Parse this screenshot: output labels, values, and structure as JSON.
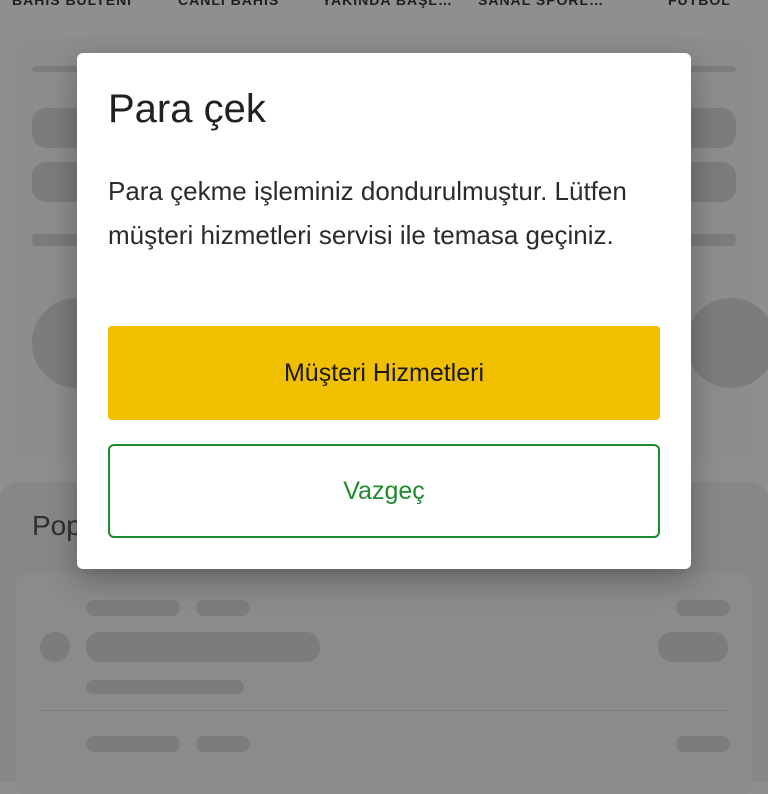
{
  "background": {
    "tabs": [
      "BAHİS BÜLTENİ",
      "CANLI BAHİS",
      "YAKINDA BAŞL…",
      "SANAL SPORL…",
      "FUTBOL"
    ],
    "popular_title": "Pop"
  },
  "dialog": {
    "title": "Para çek",
    "message": "Para çekme işleminiz dondurulmuştur. Lütfen müşteri hizmetleri servisi ile temasa geçiniz.",
    "primary_button": "Müşteri Hizmetleri",
    "secondary_button": "Vazgeç"
  },
  "colors": {
    "primary": "#f0c000",
    "secondary_border": "#1f8a2e",
    "overlay": "#8f8f8f"
  }
}
